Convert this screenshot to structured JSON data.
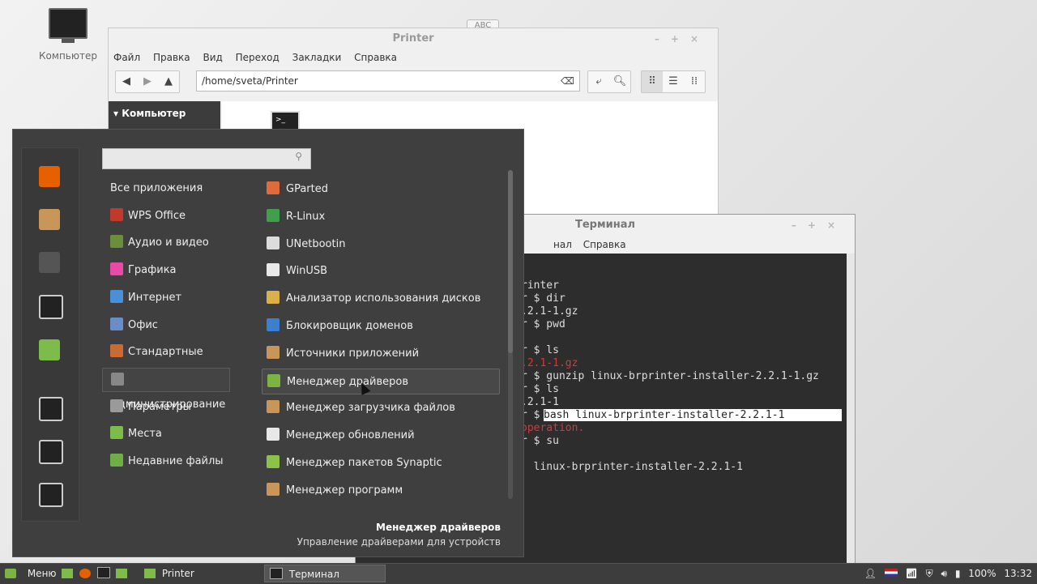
{
  "desktop": {
    "icon_label": "Компьютер",
    "abc_label": "ABC"
  },
  "file_manager": {
    "title": "Printer",
    "menu": [
      "Файл",
      "Правка",
      "Вид",
      "Переход",
      "Закладки",
      "Справка"
    ],
    "path": "/home/sveta/Printer",
    "sidebar_header": "Компьютер"
  },
  "terminal": {
    "title": "Терминал",
    "menu_visible": [
      "нал",
      "Справка"
    ],
    "lines": [
      {
        "text": "rinter",
        "row": 0,
        "style": "normal"
      },
      {
        "text": "r $ dir",
        "row": 1,
        "style": "normal"
      },
      {
        "text": ".2.1-1.gz",
        "row": 2,
        "style": "normal"
      },
      {
        "text": "r $ pwd",
        "row": 3,
        "style": "normal"
      },
      {
        "text": "r $ ls",
        "row": 5,
        "style": "normal"
      },
      {
        "text": ".2.1-1.gz",
        "row": 6,
        "style": "red"
      },
      {
        "text": "r $ gunzip linux-brprinter-installer-2.2.1-1.gz",
        "row": 7,
        "style": "normal"
      },
      {
        "text": "r $ ls",
        "row": 8,
        "style": "normal"
      },
      {
        "text": ".2.1-1",
        "row": 9,
        "style": "normal"
      },
      {
        "text": "r $ ",
        "row": 10,
        "style": "normal"
      },
      {
        "text": "bash linux-brprinter-installer-2.2.1-1",
        "row": 10,
        "style": "highlight"
      },
      {
        "text": "operation.",
        "row": 11,
        "style": "red"
      },
      {
        "text": "r $ su",
        "row": 12,
        "style": "normal"
      },
      {
        "text": "  linux-brprinter-installer-2.2.1-1",
        "row": 14,
        "style": "normal"
      }
    ]
  },
  "menu": {
    "categories": [
      {
        "label": "Все приложения",
        "icon": "none",
        "color": "",
        "selected": false
      },
      {
        "label": "WPS Office",
        "icon": "wps-icon",
        "color": "#c0392b",
        "selected": false
      },
      {
        "label": "Аудио и видео",
        "icon": "audio-video-icon",
        "color": "#6b8e3a",
        "selected": false
      },
      {
        "label": "Графика",
        "icon": "graphics-icon",
        "color": "#e84aa8",
        "selected": false
      },
      {
        "label": "Интернет",
        "icon": "internet-icon",
        "color": "#4a90d9",
        "selected": false
      },
      {
        "label": "Офис",
        "icon": "office-icon",
        "color": "#6a8cc7",
        "selected": false
      },
      {
        "label": "Стандартные",
        "icon": "accessories-icon",
        "color": "#c96b32",
        "selected": false
      },
      {
        "label": "Администрирование",
        "icon": "administration-icon",
        "color": "#888888",
        "selected": true
      },
      {
        "label": "Параметры",
        "icon": "settings-icon",
        "color": "#9a9a9a",
        "selected": false
      },
      {
        "label": "Места",
        "icon": "places-icon",
        "color": "#7dbb4a",
        "selected": false
      },
      {
        "label": "Недавние файлы",
        "icon": "recent-files-icon",
        "color": "#6fae46",
        "selected": false
      }
    ],
    "apps": [
      {
        "label": "GParted",
        "icon": "gparted-icon",
        "color": "#e06a3a",
        "selected": false
      },
      {
        "label": "R-Linux",
        "icon": "rlinux-icon",
        "color": "#3f9f4a",
        "selected": false
      },
      {
        "label": "UNetbootin",
        "icon": "unetbootin-icon",
        "color": "#dcdcdc",
        "selected": false
      },
      {
        "label": "WinUSB",
        "icon": "winusb-icon",
        "color": "#e8e8e8",
        "selected": false
      },
      {
        "label": "Анализатор использования дисков",
        "icon": "disk-usage-icon",
        "color": "#d9b04a",
        "selected": false
      },
      {
        "label": "Блокировщик доменов",
        "icon": "domain-blocker-icon",
        "color": "#3b7fd0",
        "selected": false
      },
      {
        "label": "Источники приложений",
        "icon": "software-sources-icon",
        "color": "#c9965a",
        "selected": false
      },
      {
        "label": "Менеджер драйверов",
        "icon": "driver-manager-icon",
        "color": "#7cb342",
        "selected": true
      },
      {
        "label": "Менеджер загрузчика файлов",
        "icon": "download-manager-icon",
        "color": "#c9965a",
        "selected": false
      },
      {
        "label": "Менеджер обновлений",
        "icon": "update-manager-icon",
        "color": "#e8e8e8",
        "selected": false
      },
      {
        "label": "Менеджер пакетов Synaptic",
        "icon": "synaptic-icon",
        "color": "#8bc34a",
        "selected": false
      },
      {
        "label": "Менеджер программ",
        "icon": "software-manager-icon",
        "color": "#c9965a",
        "selected": false
      }
    ],
    "description_title": "Менеджер драйверов",
    "description_text": "Управление драйверами для устройств"
  },
  "favorites": [
    {
      "icon": "firefox-icon",
      "color": "#e66000"
    },
    {
      "icon": "software-manager-icon",
      "color": "#c9965a"
    },
    {
      "icon": "system-settings-icon",
      "color": "#555555"
    },
    {
      "icon": "terminal-icon",
      "color": "#222222"
    },
    {
      "icon": "folder-icon",
      "color": "#7dbb4a"
    },
    {
      "icon": "lock-screen-icon",
      "color": "#222222"
    },
    {
      "icon": "logout-icon",
      "color": "#222222"
    },
    {
      "icon": "shutdown-icon",
      "color": "#222222"
    }
  ],
  "taskbar": {
    "menu_label": "Меню",
    "windows": [
      {
        "label": "Printer",
        "icon": "folder-icon",
        "active": false
      },
      {
        "label": "Терминал",
        "icon": "terminal-icon",
        "active": true
      }
    ],
    "battery": "100%",
    "clock": "13:32"
  }
}
